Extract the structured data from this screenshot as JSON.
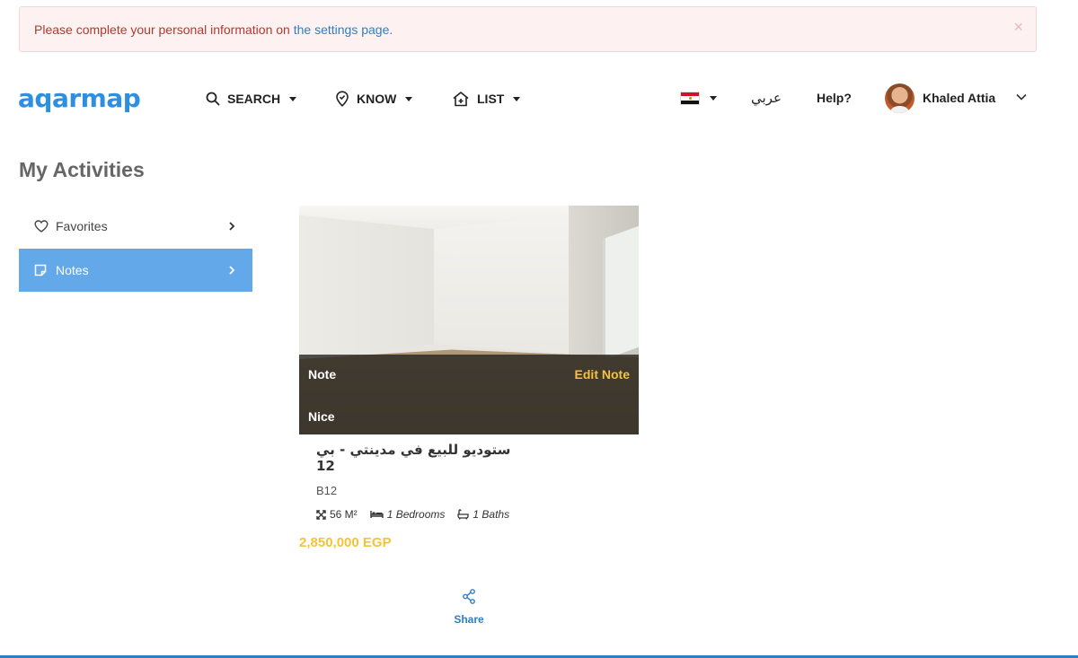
{
  "alert": {
    "text": "Please complete your personal information on ",
    "link": "the settings page.",
    "close": "×"
  },
  "header": {
    "logo": "aqarmap",
    "nav": [
      {
        "label": "SEARCH",
        "icon": "search-icon"
      },
      {
        "label": "KNOW",
        "icon": "map-pin-icon"
      },
      {
        "label": "LIST",
        "icon": "home-plus-icon"
      }
    ],
    "language": "عربي",
    "help": "Help?",
    "user_name": "Khaled Attia",
    "country_flag": "egypt-flag-icon"
  },
  "page": {
    "title": "My Activities"
  },
  "sidebar": {
    "items": [
      {
        "label": "Favorites",
        "icon": "heart-icon",
        "active": false
      },
      {
        "label": "Notes",
        "icon": "note-icon",
        "active": true
      }
    ]
  },
  "listing": {
    "note_label": "Note",
    "edit_label": "Edit Note",
    "note_text": "Nice",
    "title": "ستوديو للبيع في مدينتي - بي 12",
    "location": "B12",
    "area": "56 M²",
    "bedrooms": "1 Bedrooms",
    "baths": "1 Baths",
    "price": "2,850,000 EGP",
    "share_label": "Share"
  },
  "colors": {
    "brand_blue": "#2e8fe0",
    "active_menu": "#63a9ea",
    "price_yellow": "#f5c33b",
    "alert_red": "#b03a2e"
  }
}
